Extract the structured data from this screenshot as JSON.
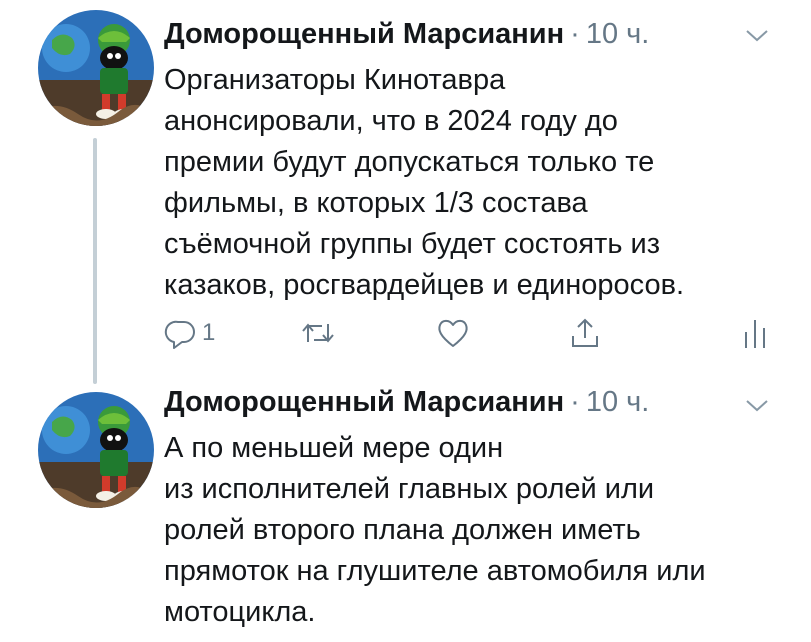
{
  "tweets": [
    {
      "author": "Доморощенный Марсианин",
      "separator": "·",
      "time": "10 ч.",
      "lines": [
        "Организаторы Кинотавра",
        "анонсировали, что в 2024 году до",
        "премии будут допускаться только те",
        "фильмы, в которых 1/3 состава",
        "съёмочной группы будет состоять из",
        "казаков, росгвардейцев и единоросов."
      ],
      "reply_count": "1",
      "icons": {
        "reply": "reply-icon",
        "retweet": "retweet-icon",
        "like": "heart-icon",
        "share": "share-icon",
        "stats": "analytics-icon",
        "menu": "chevron-down-icon"
      }
    },
    {
      "author": "Доморощенный Марсианин",
      "separator": "·",
      "time": "10 ч.",
      "lines": [
        "А по меньшей мере один",
        "из исполнителей главных ролей или",
        "ролей второго плана должен иметь",
        "прямоток на глушителе автомобиля или",
        "мотоцикла."
      ]
    }
  ],
  "colors": {
    "text": "#14171a",
    "secondary": "#657786",
    "thread_line": "#c4cfd6",
    "background": "#ffffff"
  }
}
